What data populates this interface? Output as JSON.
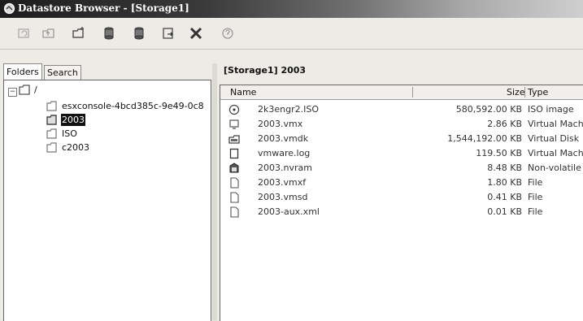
{
  "window": {
    "title": "Datastore Browser - [Storage1]"
  },
  "toolbar": {
    "buttons": [
      {
        "icon": "refresh-icon"
      },
      {
        "icon": "open-parent-folder-icon"
      },
      {
        "icon": "new-folder-icon"
      },
      {
        "icon": "upload-icon"
      },
      {
        "icon": "download-icon"
      },
      {
        "icon": "add-to-inventory-icon"
      },
      {
        "icon": "delete-icon"
      },
      {
        "icon": "help-icon"
      }
    ]
  },
  "tabs": {
    "folders": "Folders",
    "search": "Search"
  },
  "tree": {
    "root": "/",
    "items": [
      "esxconsole-4bcd385c-9e49-0c8",
      "2003",
      "ISO",
      "c2003"
    ],
    "selected": "2003"
  },
  "path_header": "[Storage1] 2003",
  "files": {
    "columns": {
      "name": "Name",
      "size": "Size",
      "type": "Type"
    },
    "rows": [
      {
        "name": "2k3engr2.ISO",
        "size": "580,592.00 KB",
        "type": "ISO image",
        "icon": "disc-image-icon"
      },
      {
        "name": "2003.vmx",
        "size": "2.86 KB",
        "type": "Virtual Machine",
        "icon": "vm-config-icon"
      },
      {
        "name": "2003.vmdk",
        "size": "1,544,192.00 KB",
        "type": "Virtual Disk",
        "icon": "virtual-disk-icon"
      },
      {
        "name": "vmware.log",
        "size": "119.50 KB",
        "type": "Virtual Machine",
        "icon": "log-file-icon"
      },
      {
        "name": "2003.nvram",
        "size": "8.48 KB",
        "type": "Non-volatile m",
        "icon": "nvram-icon"
      },
      {
        "name": "2003.vmxf",
        "size": "1.80 KB",
        "type": "File",
        "icon": "file-icon"
      },
      {
        "name": "2003.vmsd",
        "size": "0.41 KB",
        "type": "File",
        "icon": "file-icon"
      },
      {
        "name": "2003-aux.xml",
        "size": "0.01 KB",
        "type": "File",
        "icon": "file-icon"
      }
    ]
  }
}
